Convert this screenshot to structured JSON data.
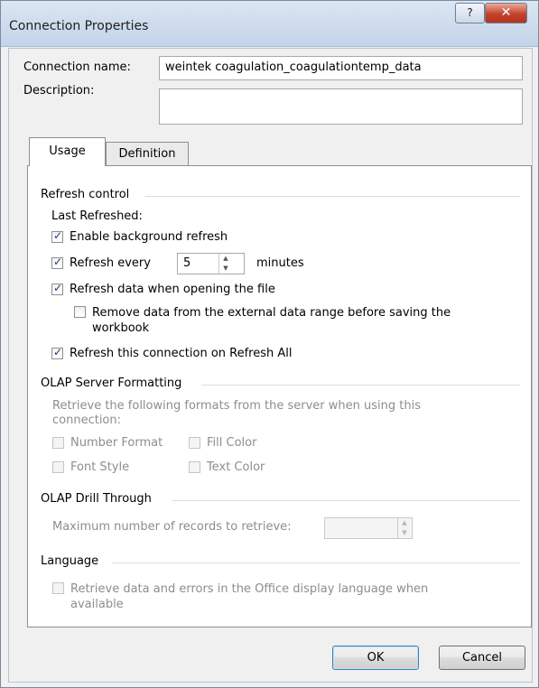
{
  "window": {
    "title": "Connection Properties",
    "help_glyph": "?",
    "close_glyph": "✕"
  },
  "connection": {
    "name_label": "Connection name:",
    "name_value": "weintek coagulation_coagulationtemp_data",
    "description_label": "Description:",
    "description_value": ""
  },
  "tabs": [
    {
      "label": "Usage",
      "active": true
    },
    {
      "label": "Definition",
      "active": false
    }
  ],
  "refresh": {
    "group_label": "Refresh control",
    "last_refreshed": "Last Refreshed:",
    "enable_background": {
      "label": "Enable background refresh",
      "checked": true
    },
    "refresh_every": {
      "label": "Refresh every",
      "checked": true,
      "value": "5",
      "unit": "minutes"
    },
    "refresh_on_open": {
      "label": "Refresh data when opening the file",
      "checked": true
    },
    "remove_data": {
      "label_line1": "Remove data from the external data range before saving the",
      "label_line2": "workbook",
      "checked": false
    },
    "refresh_all": {
      "label": "Refresh this connection on Refresh All",
      "checked": true
    }
  },
  "olap_formatting": {
    "group_label": "OLAP Server Formatting",
    "description_line1": "Retrieve the following formats from the server when using this",
    "description_line2": "connection:",
    "options": [
      {
        "label": "Number Format",
        "checked": false,
        "enabled": false
      },
      {
        "label": "Fill Color",
        "checked": false,
        "enabled": false
      },
      {
        "label": "Font Style",
        "checked": false,
        "enabled": false
      },
      {
        "label": "Text Color",
        "checked": false,
        "enabled": false
      }
    ]
  },
  "olap_drill": {
    "group_label": "OLAP Drill Through",
    "max_records_label": "Maximum number of records to retrieve:",
    "max_records_value": ""
  },
  "language": {
    "group_label": "Language",
    "option_line1": "Retrieve data and errors in the Office display language when",
    "option_line2": "available",
    "checked": false,
    "enabled": false
  },
  "buttons": {
    "ok": "OK",
    "cancel": "Cancel"
  }
}
